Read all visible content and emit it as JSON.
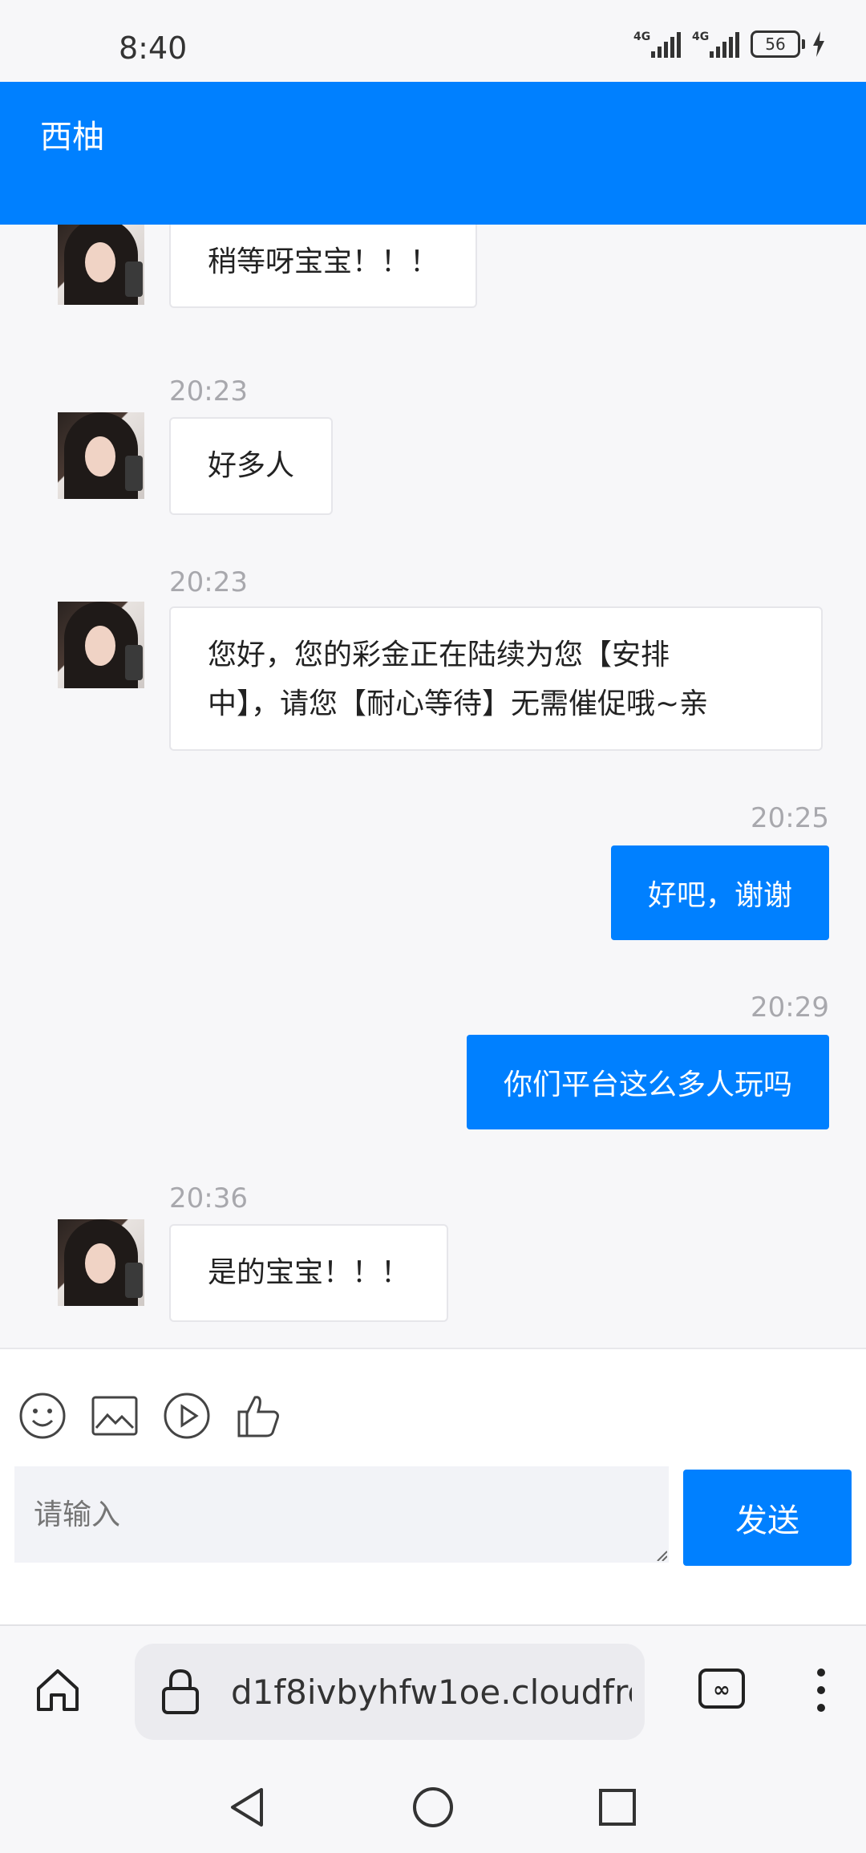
{
  "status_bar": {
    "time": "8:40",
    "network1": "4G",
    "network2": "4G",
    "battery": "56"
  },
  "header": {
    "title": "西柚"
  },
  "messages": [
    {
      "side": "left",
      "time": "",
      "text": "稍等呀宝宝！！！"
    },
    {
      "side": "left",
      "time": "20:23",
      "text": "好多人"
    },
    {
      "side": "left",
      "time": "20:23",
      "line1": "您好，您的彩金正在陆续为您【安排",
      "line2": "中】，请您【耐心等待】无需催促哦~亲"
    },
    {
      "side": "right",
      "time": "20:25",
      "text": "好吧，谢谢"
    },
    {
      "side": "right",
      "time": "20:29",
      "text": "你们平台这么多人玩吗"
    },
    {
      "side": "left",
      "time": "20:36",
      "text": "是的宝宝！！！"
    }
  ],
  "composer": {
    "tools": [
      "emoji-icon",
      "image-icon",
      "video-icon",
      "thumbs-up-icon"
    ],
    "placeholder": "请输入",
    "send_label": "发送"
  },
  "browser": {
    "url": "d1f8ivbyhfw1oe.cloudfro"
  },
  "colors": {
    "accent": "#0080ff",
    "background": "#f7f7f9"
  }
}
